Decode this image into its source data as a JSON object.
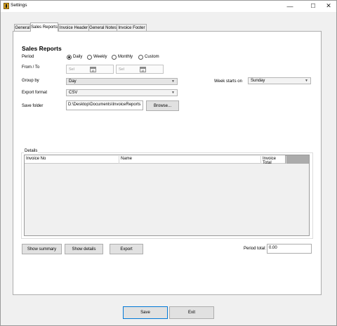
{
  "window": {
    "title": "Settings",
    "minimize_glyph": "—",
    "maximize_glyph": "☐",
    "close_glyph": "✕"
  },
  "tabs": [
    {
      "label": "General",
      "active": false
    },
    {
      "label": "Sales Reports",
      "active": true
    },
    {
      "label": "Invoice Header",
      "active": false
    },
    {
      "label": "General Notes",
      "active": false
    },
    {
      "label": "Invoice Footer",
      "active": false
    }
  ],
  "sales_reports": {
    "title": "Sales Reports",
    "period": {
      "label": "Period",
      "options": [
        "Daily",
        "Weekly",
        "Monthly",
        "Custom"
      ],
      "selected": "Daily"
    },
    "from_to": {
      "label": "From / To",
      "from_placeholder": "Sel",
      "to_placeholder": "Sel",
      "calendar_glyph": "15"
    },
    "group_by": {
      "label": "Group by",
      "value": "Day"
    },
    "week_starts_on": {
      "label": "Week starts on",
      "value": "Sunday"
    },
    "export_format": {
      "label": "Export format",
      "value": "CSV"
    },
    "save_folder": {
      "label": "Save folder",
      "value": "D:\\Desktop\\Documents\\InvoiceReports",
      "browse_label": "Browse..."
    },
    "details": {
      "label": "Details",
      "columns": [
        "Invoice No",
        "Name",
        "Invoice Total"
      ],
      "rows": []
    },
    "buttons": {
      "show_summary": "Show summary",
      "show_details": "Show details",
      "export": "Export"
    },
    "period_total": {
      "label": "Period total:",
      "value": "0.00"
    }
  },
  "footer": {
    "save_label": "Save",
    "exit_label": "Exit"
  }
}
